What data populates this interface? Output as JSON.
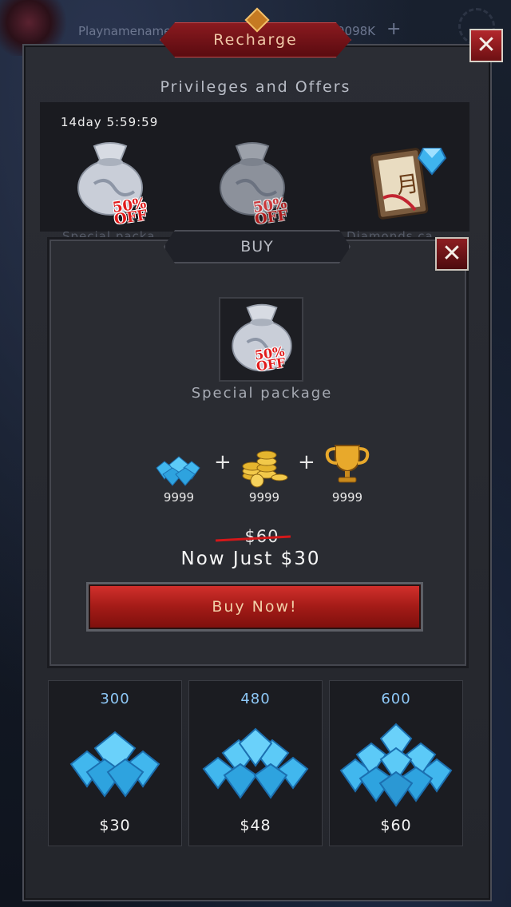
{
  "topbar": {
    "player_name": "Playnamename",
    "currency": "9098K",
    "plus": "+"
  },
  "dialog": {
    "title": "Recharge",
    "close_label": "✕",
    "section_title": "Privileges and Offers"
  },
  "offers": {
    "timer": "14day 5:59:59",
    "items": [
      {
        "caption": "Special packa",
        "badge": "50%\nOFF"
      },
      {
        "caption": "",
        "badge": "50%\nOFF"
      },
      {
        "caption": "Diamonds ca",
        "badge": ""
      }
    ]
  },
  "buy": {
    "tab_label": "BUY",
    "close_label": "✕",
    "package_name": "Special package",
    "badge": "50%\nOFF",
    "rewards": [
      {
        "icon": "diamonds-icon",
        "value": "9999"
      },
      {
        "icon": "gold-coins-icon",
        "value": "9999"
      },
      {
        "icon": "trophy-icon",
        "value": "9999"
      }
    ],
    "plus": "+",
    "old_price": "$60",
    "now_price": "Now Just $30",
    "button_label": "Buy Now!"
  },
  "diamond_packs": [
    {
      "amount": "300",
      "price": "$30"
    },
    {
      "amount": "480",
      "price": "$48"
    },
    {
      "amount": "600",
      "price": "$60"
    }
  ],
  "colors": {
    "accent_red": "#a31b17",
    "gem_blue": "#3fb4ee",
    "panel": "#2b2d34"
  }
}
